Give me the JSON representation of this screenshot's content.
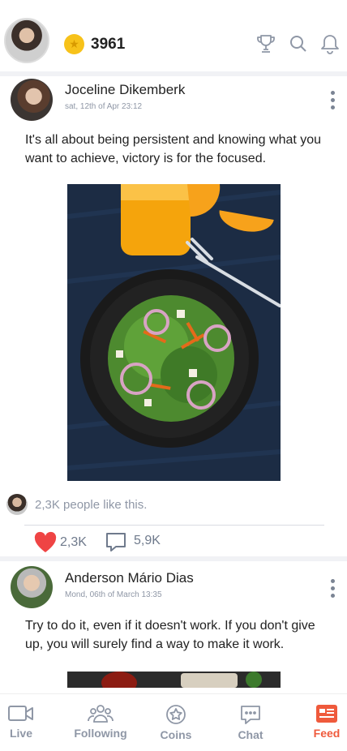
{
  "header": {
    "coins": "3961",
    "icons": [
      "trophy-icon",
      "search-icon",
      "bell-icon"
    ]
  },
  "posts": [
    {
      "author": "Joceline Dikemberk",
      "date": "sat, 12th of Apr 23:12",
      "text": "It's all about being persistent and knowing what you want to achieve, victory is for the focused.",
      "likes_summary": "2,3K people like this.",
      "like_count": "2,3K",
      "comment_count": "5,9K"
    },
    {
      "author": "Anderson Mário Dias",
      "date": "Mond, 06th of March 13:35",
      "text": "Try to do it, even if it doesn't work. If you don't give up, you will surely find a way to make it work."
    }
  ],
  "nav": {
    "items": [
      {
        "label": "Live",
        "icon": "video-camera-icon"
      },
      {
        "label": "Following",
        "icon": "group-icon"
      },
      {
        "label": "Coins",
        "icon": "star-coin-icon"
      },
      {
        "label": "Chat",
        "icon": "chat-bubble-icon"
      },
      {
        "label": "Feed",
        "icon": "feed-icon"
      }
    ],
    "active": "Feed",
    "accent_color": "#ef5a3c",
    "inactive_color": "#8f97a6"
  },
  "colors": {
    "like_heart": "#ef4444",
    "coin": "#f7c21a"
  }
}
